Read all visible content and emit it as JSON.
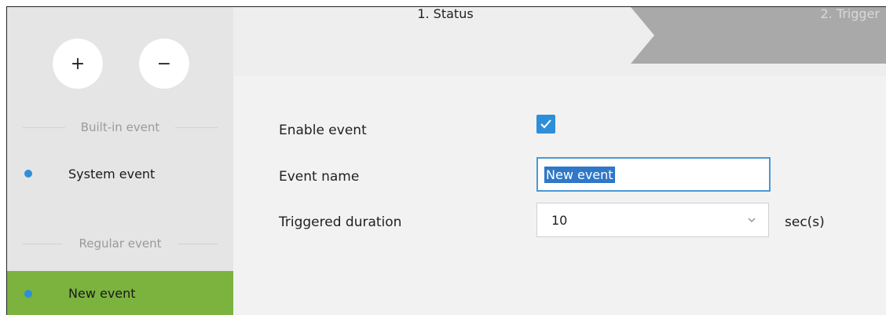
{
  "sidebar": {
    "add_label": "+",
    "remove_label": "−",
    "builtin_heading": "Built-in event",
    "system_event": "System event",
    "regular_heading": "Regular event",
    "new_event": "New event"
  },
  "steps": {
    "step1": "1. Status",
    "step2": "2. Trigger"
  },
  "form": {
    "enable_label": "Enable event",
    "enable_checked": true,
    "name_label": "Event name",
    "name_value": "New event",
    "duration_label": "Triggered duration",
    "duration_value": "10",
    "duration_unit": "sec(s)"
  },
  "colors": {
    "accent_blue": "#2d8fd9",
    "selected_green": "#7bb33e"
  },
  "icons": {
    "checkbox": "check-icon",
    "select": "chevron-down-icon"
  }
}
